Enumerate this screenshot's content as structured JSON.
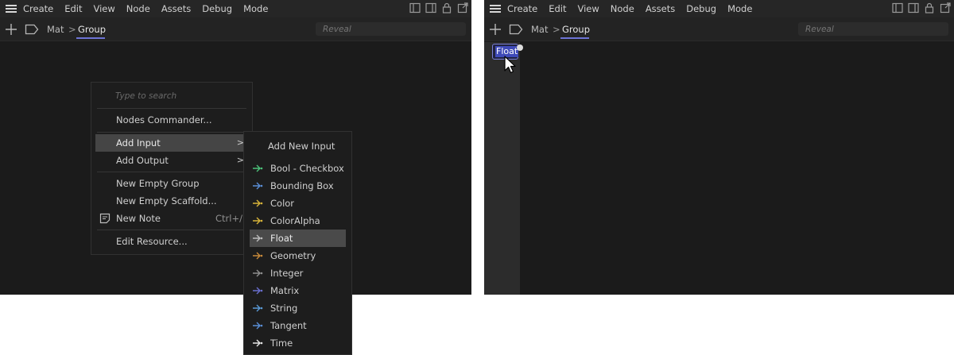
{
  "menubar": {
    "items": [
      "Create",
      "Edit",
      "View",
      "Node",
      "Assets",
      "Debug",
      "Mode"
    ]
  },
  "breadcrumb": {
    "root": "Mat",
    "separator": ">",
    "current": "Group"
  },
  "search": {
    "placeholder": "Reveal"
  },
  "context_menu": {
    "search_placeholder": "Type to search",
    "nodes_commander": "Nodes Commander...",
    "add_input": "Add Input",
    "add_output": "Add Output",
    "arrow": ">",
    "new_empty_group": "New Empty Group",
    "new_empty_scaffold": "New Empty Scaffold...",
    "new_note": "New Note",
    "new_note_shortcut": "Ctrl+/",
    "edit_resource": "Edit Resource..."
  },
  "submenu": {
    "header": "Add New Input",
    "items": [
      {
        "label": "Bool - Checkbox",
        "color": "#4cc27a"
      },
      {
        "label": "Bounding Box",
        "color": "#5a8ed6"
      },
      {
        "label": "Color",
        "color": "#d8b43a"
      },
      {
        "label": "ColorAlpha",
        "color": "#d8b43a"
      },
      {
        "label": "Float",
        "color": "#bdbdbd"
      },
      {
        "label": "Geometry",
        "color": "#c88a3a"
      },
      {
        "label": "Integer",
        "color": "#8f8f8f"
      },
      {
        "label": "Matrix",
        "color": "#6a6fd0"
      },
      {
        "label": "String",
        "color": "#5a9ad6"
      },
      {
        "label": "Tangent",
        "color": "#5a8ed6"
      },
      {
        "label": "Time",
        "color": "#e6e6e6"
      }
    ],
    "selected": "Float"
  },
  "right_panel": {
    "node_label": "Float"
  },
  "colors": {
    "accent": "#6d74d6",
    "panel_bg": "#1b1b1b",
    "menubar_bg": "#262626",
    "highlight": "#454545"
  }
}
